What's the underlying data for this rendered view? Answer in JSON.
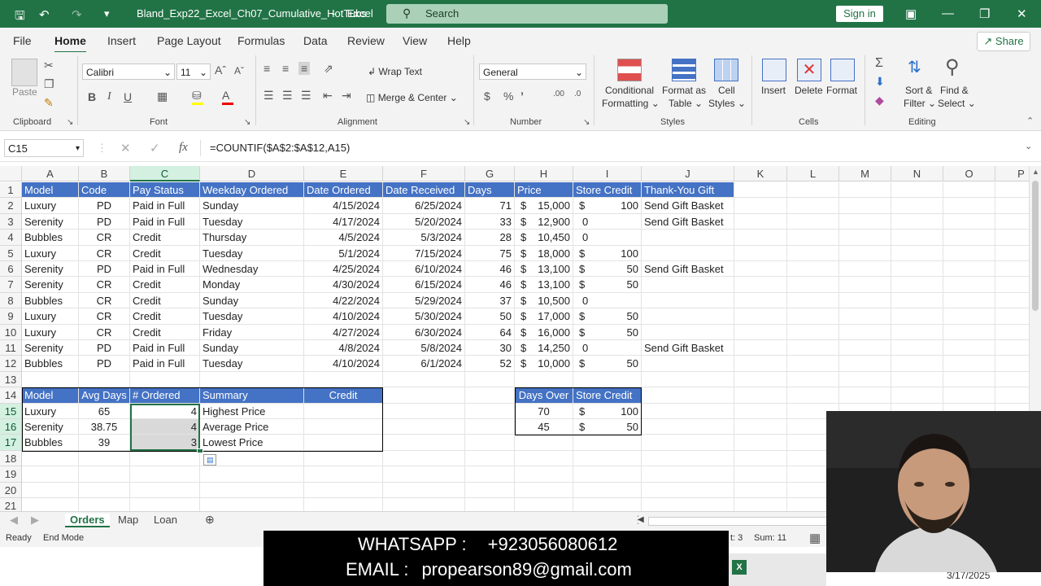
{
  "titlebar": {
    "filename": "Bland_Exp22_Excel_Ch07_Cumulative_HotTubs",
    "app": "Excel",
    "search_placeholder": "Search",
    "signin": "Sign in"
  },
  "ribbon_tabs": [
    "File",
    "Home",
    "Insert",
    "Page Layout",
    "Formulas",
    "Data",
    "Review",
    "View",
    "Help"
  ],
  "share_label": "Share",
  "ribbon": {
    "paste": "Paste",
    "font_name": "Calibri",
    "font_size": "11",
    "wrap_text": "Wrap Text",
    "merge_center": "Merge & Center",
    "number_format": "General",
    "conditional_formatting": [
      "Conditional",
      "Formatting"
    ],
    "format_as_table": [
      "Format as",
      "Table"
    ],
    "cell_styles": [
      "Cell",
      "Styles"
    ],
    "insert": "Insert",
    "delete": "Delete",
    "format": "Format",
    "sort_filter": [
      "Sort &",
      "Filter"
    ],
    "find_select": [
      "Find &",
      "Select"
    ],
    "groups": [
      "Clipboard",
      "Font",
      "Alignment",
      "Number",
      "Styles",
      "Cells",
      "Editing"
    ]
  },
  "formula_bar": {
    "name_box": "C15",
    "formula": "=COUNTIF($A$2:$A$12,A15)"
  },
  "columns": [
    "A",
    "B",
    "C",
    "D",
    "E",
    "F",
    "G",
    "H",
    "I",
    "J",
    "K",
    "L",
    "M",
    "N",
    "O",
    "P"
  ],
  "rows": [
    "1",
    "2",
    "3",
    "4",
    "5",
    "6",
    "7",
    "8",
    "9",
    "10",
    "11",
    "12",
    "13",
    "14",
    "15",
    "16",
    "17",
    "18",
    "19",
    "20",
    "21"
  ],
  "table_header": [
    "Model",
    "Code",
    "Pay Status",
    "Weekday Ordered",
    "Date Ordered",
    "Date Received",
    "Days",
    "Price",
    "Store Credit",
    "Thank-You Gift"
  ],
  "table_rows": [
    [
      "Luxury",
      "PD",
      "Paid in Full",
      "Sunday",
      "4/15/2024",
      "6/25/2024",
      "71",
      "15,000",
      "100",
      "Send Gift Basket"
    ],
    [
      "Serenity",
      "PD",
      "Paid in Full",
      "Tuesday",
      "4/17/2024",
      "5/20/2024",
      "33",
      "12,900",
      "0",
      "Send Gift Basket"
    ],
    [
      "Bubbles",
      "CR",
      "Credit",
      "Thursday",
      "4/5/2024",
      "5/3/2024",
      "28",
      "10,450",
      "0",
      ""
    ],
    [
      "Luxury",
      "CR",
      "Credit",
      "Tuesday",
      "5/1/2024",
      "7/15/2024",
      "75",
      "18,000",
      "100",
      ""
    ],
    [
      "Serenity",
      "PD",
      "Paid in Full",
      "Wednesday",
      "4/25/2024",
      "6/10/2024",
      "46",
      "13,100",
      "50",
      "Send Gift Basket"
    ],
    [
      "Serenity",
      "CR",
      "Credit",
      "Monday",
      "4/30/2024",
      "6/15/2024",
      "46",
      "13,100",
      "50",
      ""
    ],
    [
      "Bubbles",
      "CR",
      "Credit",
      "Sunday",
      "4/22/2024",
      "5/29/2024",
      "37",
      "10,500",
      "0",
      ""
    ],
    [
      "Luxury",
      "CR",
      "Credit",
      "Tuesday",
      "4/10/2024",
      "5/30/2024",
      "50",
      "17,000",
      "50",
      ""
    ],
    [
      "Luxury",
      "CR",
      "Credit",
      "Friday",
      "4/27/2024",
      "6/30/2024",
      "64",
      "16,000",
      "50",
      ""
    ],
    [
      "Serenity",
      "PD",
      "Paid in Full",
      "Sunday",
      "4/8/2024",
      "5/8/2024",
      "30",
      "14,250",
      "0",
      "Send Gift Basket"
    ],
    [
      "Bubbles",
      "PD",
      "Paid in Full",
      "Tuesday",
      "4/10/2024",
      "6/1/2024",
      "52",
      "10,000",
      "50",
      ""
    ]
  ],
  "currency_symbol": "$",
  "summary_header": [
    "Model",
    "Avg Days",
    "# Ordered",
    "Summary",
    "Credit"
  ],
  "summary_rows": [
    [
      "Luxury",
      "65",
      "4",
      "Highest Price"
    ],
    [
      "Serenity",
      "38.75",
      "4",
      "Average Price"
    ],
    [
      "Bubbles",
      "39",
      "3",
      "Lowest Price"
    ]
  ],
  "days_table_header": [
    "Days Over",
    "Store Credit"
  ],
  "days_table_rows": [
    [
      "70",
      "100"
    ],
    [
      "45",
      "50"
    ]
  ],
  "sheet_tabs": [
    "Orders",
    "Map",
    "Loan"
  ],
  "status": {
    "ready": "Ready",
    "mode": "End Mode",
    "count": "t: 3",
    "sum": "Sum: 11"
  },
  "overlay": {
    "line1_label": "WHATSAPP :",
    "line1_value": "+923056080612",
    "line2_label": "EMAIL :",
    "line2_value": "propearson89@gmail.com"
  },
  "taskbar_date": "3/17/2025"
}
